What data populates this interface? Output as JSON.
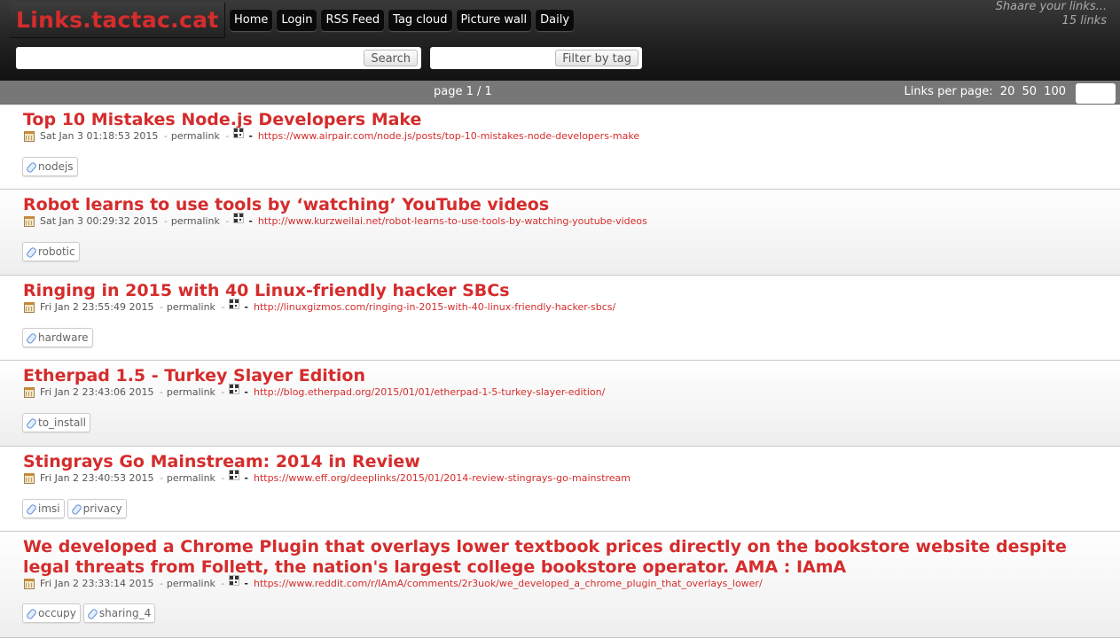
{
  "header": {
    "site_title": "Links.tactac.cat",
    "nav": [
      "Home",
      "Login",
      "RSS Feed",
      "Tag cloud",
      "Picture wall",
      "Daily"
    ],
    "tagline": "Shaare your links...",
    "link_count": "15 links",
    "search_button": "Search",
    "tag_filter_button": "Filter by tag"
  },
  "paging": {
    "page_info": "page 1 / 1",
    "per_page_label": "Links per page:",
    "per_page_options": [
      "20",
      "50",
      "100"
    ]
  },
  "links": [
    {
      "title": "Top 10 Mistakes Node.js Developers Make",
      "date": "Sat Jan 3 01:18:53 2015",
      "permalink": "permalink",
      "url": "https://www.airpair.com/node.js/posts/top-10-mistakes-node-developers-make",
      "tags": [
        "nodejs"
      ]
    },
    {
      "title": "Robot learns to use tools by ‘watching’ YouTube videos",
      "date": "Sat Jan 3 00:29:32 2015",
      "permalink": "permalink",
      "url": "http://www.kurzweilai.net/robot-learns-to-use-tools-by-watching-youtube-videos",
      "tags": [
        "robotic"
      ]
    },
    {
      "title": "Ringing in 2015 with 40 Linux-friendly hacker SBCs",
      "date": "Fri Jan 2 23:55:49 2015",
      "permalink": "permalink",
      "url": "http://linuxgizmos.com/ringing-in-2015-with-40-linux-friendly-hacker-sbcs/",
      "tags": [
        "hardware"
      ]
    },
    {
      "title": "Etherpad 1.5 - Turkey Slayer Edition",
      "date": "Fri Jan 2 23:43:06 2015",
      "permalink": "permalink",
      "url": "http://blog.etherpad.org/2015/01/01/etherpad-1-5-turkey-slayer-edition/",
      "tags": [
        "to_install"
      ]
    },
    {
      "title": "Stingrays Go Mainstream: 2014 in Review",
      "date": "Fri Jan 2 23:40:53 2015",
      "permalink": "permalink",
      "url": "https://www.eff.org/deeplinks/2015/01/2014-review-stingrays-go-mainstream",
      "tags": [
        "imsi",
        "privacy"
      ]
    },
    {
      "title": "We developed a Chrome Plugin that overlays lower textbook prices directly on the bookstore website despite legal threats from Follett, the nation's largest college bookstore operator. AMA : IAmA",
      "date": "Fri Jan 2 23:33:14 2015",
      "permalink": "permalink",
      "url": "https://www.reddit.com/r/IAmA/comments/2r3uok/we_developed_a_chrome_plugin_that_overlays_lower/",
      "tags": [
        "occupy",
        "sharing_4"
      ]
    }
  ]
}
